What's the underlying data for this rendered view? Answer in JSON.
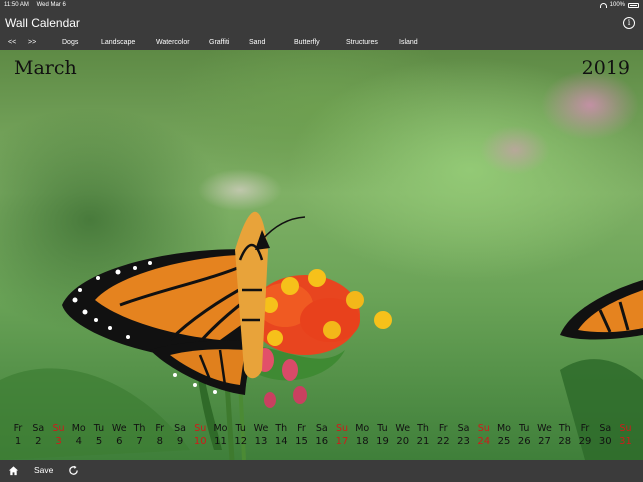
{
  "status": {
    "time": "11:50 AM",
    "date": "Wed Mar 6",
    "battery": "100%"
  },
  "app": {
    "title": "Wall Calendar"
  },
  "nav": {
    "prev": "<<",
    "next": ">>",
    "categories": [
      "Dogs",
      "Landscape",
      "Watercolor",
      "Graffiti",
      "Sand",
      "Butterfly",
      "Structures",
      "Island"
    ]
  },
  "calendar": {
    "month": "March",
    "year": "2019",
    "days": [
      {
        "name": "Fr",
        "date": "1",
        "sunday": false
      },
      {
        "name": "Sa",
        "date": "2",
        "sunday": false
      },
      {
        "name": "Su",
        "date": "3",
        "sunday": true
      },
      {
        "name": "Mo",
        "date": "4",
        "sunday": false
      },
      {
        "name": "Tu",
        "date": "5",
        "sunday": false
      },
      {
        "name": "We",
        "date": "6",
        "sunday": false
      },
      {
        "name": "Th",
        "date": "7",
        "sunday": false
      },
      {
        "name": "Fr",
        "date": "8",
        "sunday": false
      },
      {
        "name": "Sa",
        "date": "9",
        "sunday": false
      },
      {
        "name": "Su",
        "date": "10",
        "sunday": true
      },
      {
        "name": "Mo",
        "date": "11",
        "sunday": false
      },
      {
        "name": "Tu",
        "date": "12",
        "sunday": false
      },
      {
        "name": "We",
        "date": "13",
        "sunday": false
      },
      {
        "name": "Th",
        "date": "14",
        "sunday": false
      },
      {
        "name": "Fr",
        "date": "15",
        "sunday": false
      },
      {
        "name": "Sa",
        "date": "16",
        "sunday": false
      },
      {
        "name": "Su",
        "date": "17",
        "sunday": true
      },
      {
        "name": "Mo",
        "date": "18",
        "sunday": false
      },
      {
        "name": "Tu",
        "date": "19",
        "sunday": false
      },
      {
        "name": "We",
        "date": "20",
        "sunday": false
      },
      {
        "name": "Th",
        "date": "21",
        "sunday": false
      },
      {
        "name": "Fr",
        "date": "22",
        "sunday": false
      },
      {
        "name": "Sa",
        "date": "23",
        "sunday": false
      },
      {
        "name": "Su",
        "date": "24",
        "sunday": true
      },
      {
        "name": "Mo",
        "date": "25",
        "sunday": false
      },
      {
        "name": "Tu",
        "date": "26",
        "sunday": false
      },
      {
        "name": "We",
        "date": "27",
        "sunday": false
      },
      {
        "name": "Th",
        "date": "28",
        "sunday": false
      },
      {
        "name": "Fr",
        "date": "29",
        "sunday": false
      },
      {
        "name": "Sa",
        "date": "30",
        "sunday": false
      },
      {
        "name": "Su",
        "date": "31",
        "sunday": true
      }
    ]
  },
  "toolbar": {
    "home_icon": "home-icon",
    "save_label": "Save",
    "refresh_icon": "refresh-icon"
  },
  "colors": {
    "bar": "#3b3b3b",
    "sunday": "#d01a1a",
    "text_dark": "#111111"
  }
}
